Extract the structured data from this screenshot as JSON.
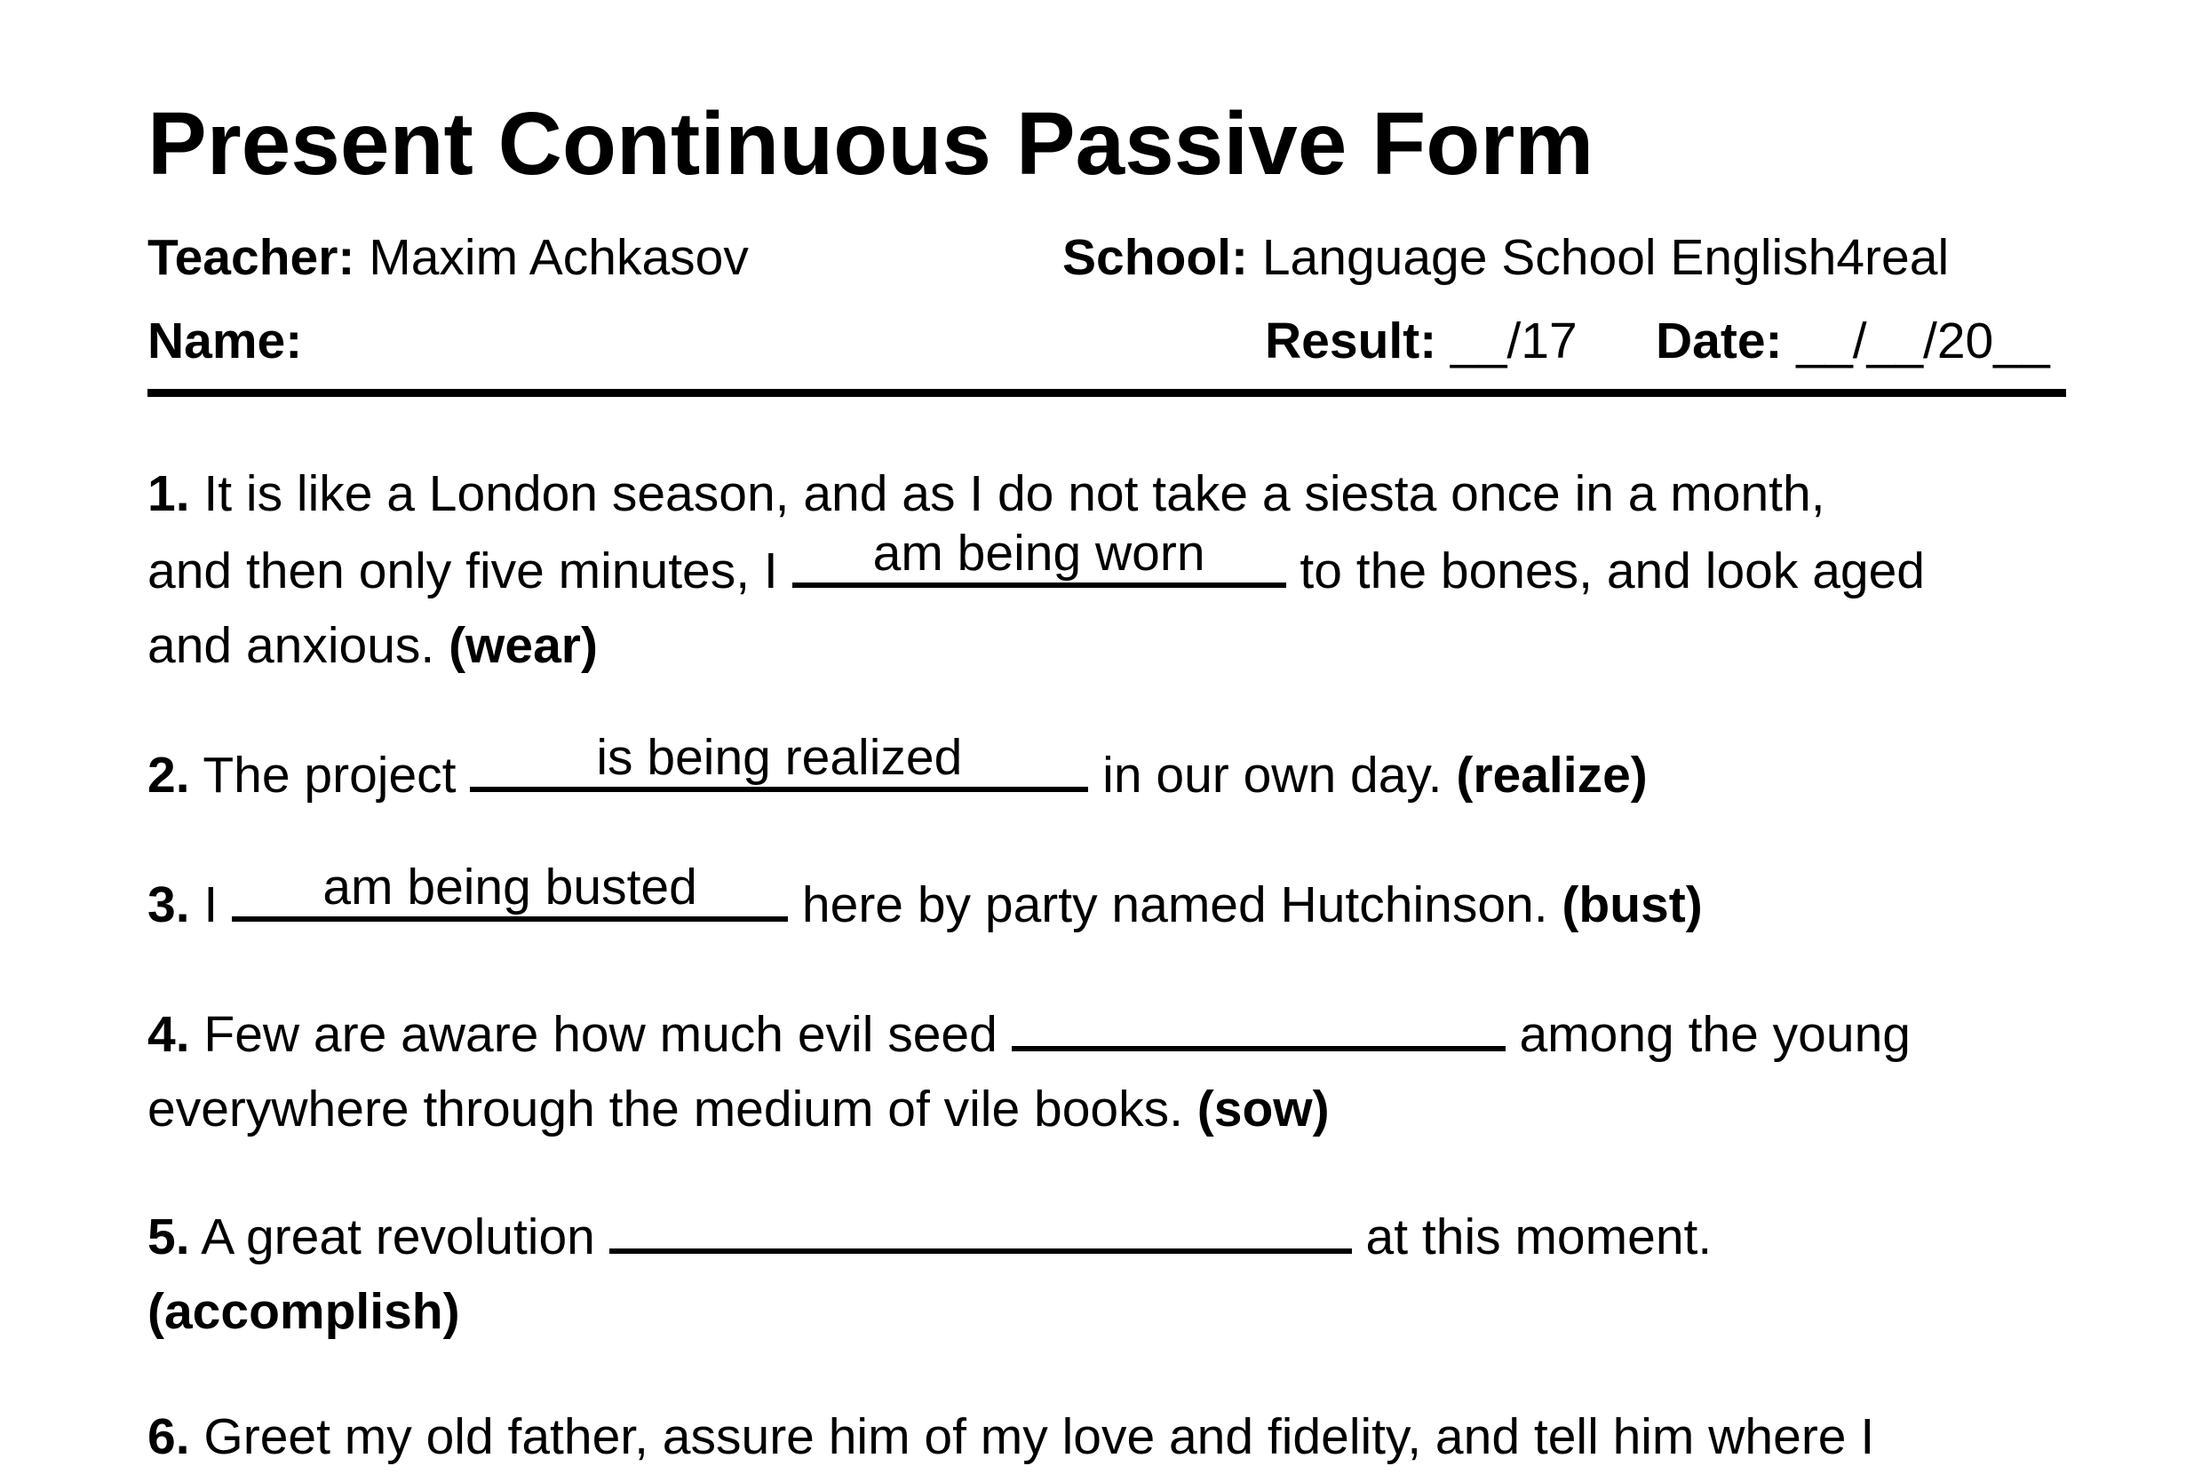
{
  "worksheet": {
    "title": "Present Continuous Passive Form",
    "teacher_label": "Teacher:",
    "teacher_name": "Maxim Achkasov",
    "school_label": "School:",
    "school_name": "Language School English4real",
    "name_label": "Name:",
    "result_label": "Result:",
    "result_value": "__/17",
    "date_label": "Date:",
    "date_value": "__/__/20__"
  },
  "questions": [
    {
      "number": "1.",
      "lines": [
        {
          "before": "It is like a London season, and as I do not take a siesta once in a month,"
        },
        {
          "before": "and then only five minutes, I ",
          "answer": "am being worn",
          "after": " to the bones, and look aged"
        },
        {
          "before": "and anxious. ",
          "hint": "(wear)"
        }
      ]
    },
    {
      "number": "2.",
      "lines": [
        {
          "before": "The project ",
          "answer": "is being realized",
          "after": " in our own day. ",
          "hint": "(realize)"
        }
      ]
    },
    {
      "number": "3.",
      "lines": [
        {
          "before": "I ",
          "answer": "am being busted",
          "after": " here by party named Hutchinson. ",
          "hint": "(bust)"
        }
      ]
    },
    {
      "number": "4.",
      "lines": [
        {
          "before": "Few are aware how much evil seed ",
          "answer": "",
          "after": " among the young"
        },
        {
          "before": "everywhere through the medium of vile books. ",
          "hint": "(sow)"
        }
      ]
    },
    {
      "number": "5.",
      "lines": [
        {
          "before": "A great revolution ",
          "answer": "",
          "after": " at this moment."
        },
        {
          "hint": "(accomplish)"
        }
      ]
    },
    {
      "number": "6.",
      "lines": [
        {
          "before": "Greet my old father, assure him of my love and fidelity, and tell him where I"
        }
      ]
    }
  ]
}
